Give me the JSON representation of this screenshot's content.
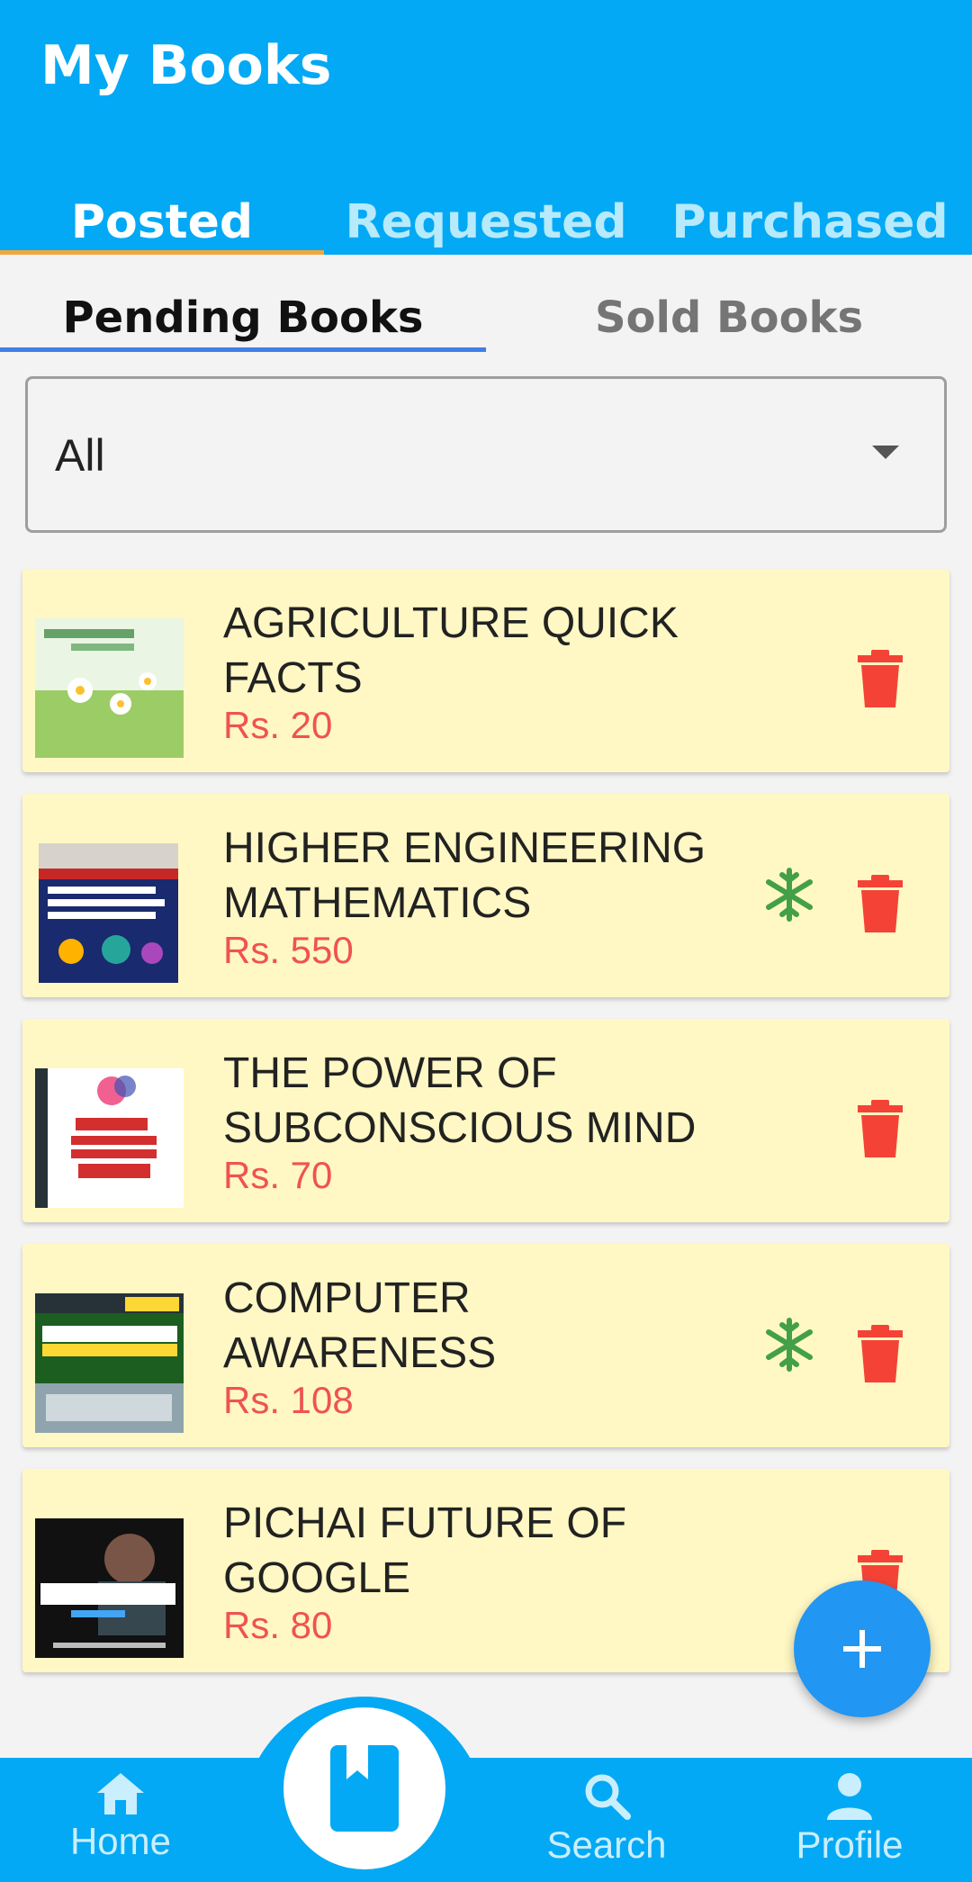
{
  "app": {
    "title": "My Books"
  },
  "tabs": [
    "Posted",
    "Requested",
    "Purchased"
  ],
  "subtabs": [
    "Pending Books",
    "Sold Books"
  ],
  "filter": {
    "selected": "All"
  },
  "books": [
    {
      "title": "AGRICULTURE QUICK FACTS",
      "price": "Rs. 20",
      "status_icon": null
    },
    {
      "title": "HIGHER ENGINEERING MATHEMATICS",
      "price": "Rs. 550",
      "status_icon": "snowflake-icon"
    },
    {
      "title": "THE POWER OF SUBCONSCIOUS MIND",
      "price": "Rs. 70",
      "status_icon": null
    },
    {
      "title": "COMPUTER AWARENESS",
      "price": "Rs. 108",
      "status_icon": "snowflake-icon"
    },
    {
      "title": "PICHAI FUTURE OF GOOGLE",
      "price": "Rs. 80",
      "status_icon": null
    }
  ],
  "nav": {
    "home": "Home",
    "search": "Search",
    "profile": "Profile"
  },
  "colors": {
    "primary": "#03a9f4",
    "card": "#fff8c4",
    "price": "#ef5350",
    "delete": "#f44336",
    "snowflake": "#43a047",
    "tab_indicator": "#f4a73c"
  }
}
